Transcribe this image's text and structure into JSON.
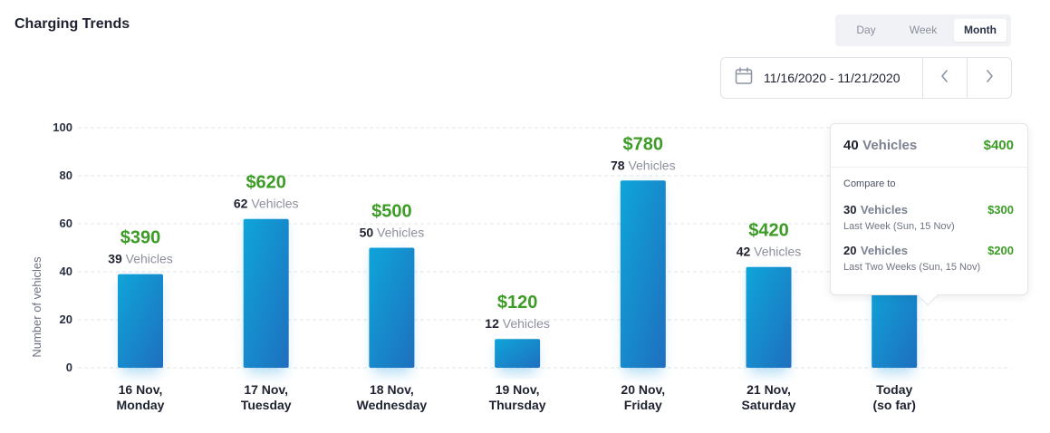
{
  "header": {
    "title": "Charging Trends"
  },
  "toggle": {
    "options": [
      "Day",
      "Week",
      "Month"
    ],
    "active": "Month"
  },
  "date_range": {
    "label": "11/16/2020 - 11/21/2020"
  },
  "icons": {
    "calendar": "calendar-icon",
    "prev": "chevron-left-icon",
    "next": "chevron-right-icon"
  },
  "colors": {
    "accent_green": "#3c9c26",
    "bar_top": "#0ea5d9",
    "bar_bottom": "#1f6fbf"
  },
  "chart_data": {
    "type": "bar",
    "ylabel": "Number of vehicles",
    "ylim": [
      0,
      100
    ],
    "yticks": [
      0,
      20,
      40,
      60,
      80,
      100
    ],
    "grid": true,
    "unit_label": "Vehicles",
    "categories": [
      [
        "16 Nov,",
        "Monday"
      ],
      [
        "17 Nov,",
        "Tuesday"
      ],
      [
        "18 Nov,",
        "Wednesday"
      ],
      [
        "19 Nov,",
        "Thursday"
      ],
      [
        "20 Nov,",
        "Friday"
      ],
      [
        "21 Nov,",
        "Saturday"
      ],
      [
        "Today",
        "(so far)"
      ]
    ],
    "values": [
      39,
      62,
      50,
      12,
      78,
      42,
      40
    ],
    "revenue": [
      "$390",
      "$620",
      "$500",
      "$120",
      "$780",
      "$420",
      "$400"
    ]
  },
  "tooltip": {
    "count": "40",
    "unit": "Vehicles",
    "revenue": "$400",
    "compare_label": "Compare to",
    "comparisons": [
      {
        "count": "30",
        "unit": "Vehicles",
        "revenue": "$300",
        "period": "Last Week (Sun, 15 Nov)"
      },
      {
        "count": "20",
        "unit": "Vehicles",
        "revenue": "$200",
        "period": "Last Two Weeks (Sun, 15 Nov)"
      }
    ]
  }
}
